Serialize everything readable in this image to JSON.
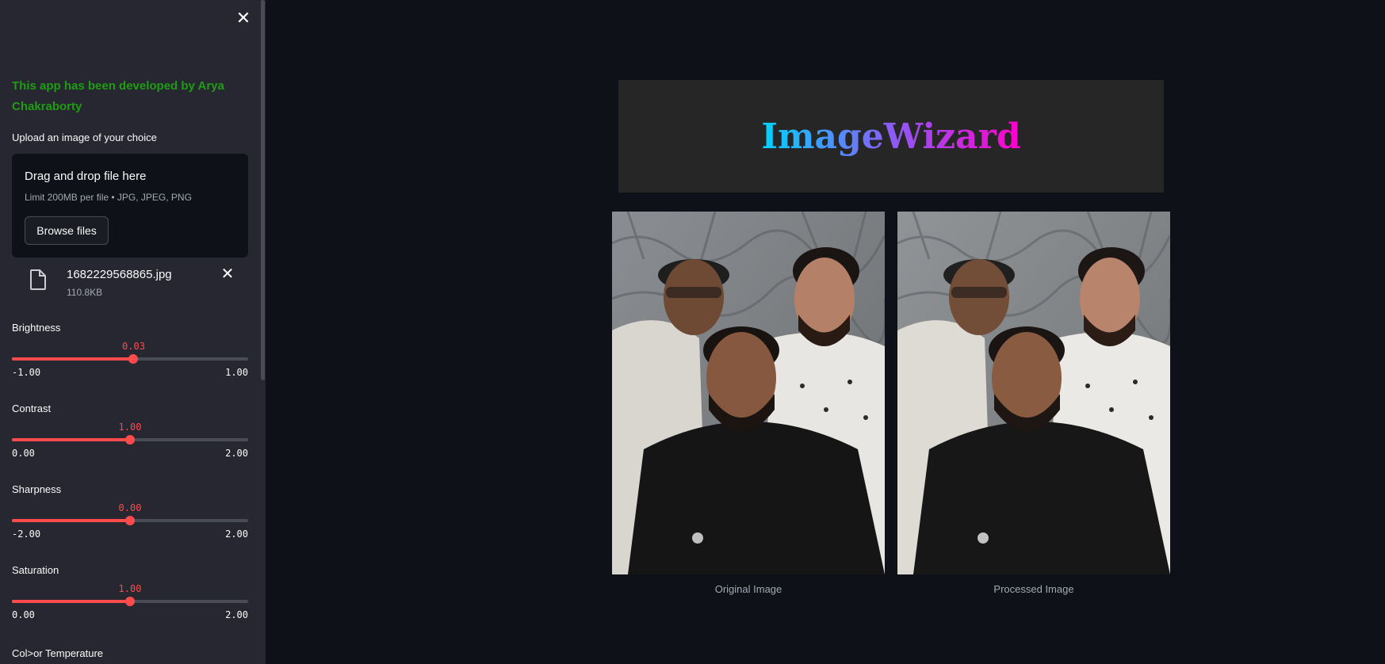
{
  "sidebar": {
    "close_icon": "close-icon",
    "developer_note": "This app has been developed by Arya Chakraborty",
    "upload": {
      "label": "Upload an image of your choice",
      "dropzone_title": "Drag and drop file here",
      "dropzone_limit": "Limit 200MB per file • JPG, JPEG, PNG",
      "browse_label": "Browse files"
    },
    "file": {
      "name": "1682229568865.jpg",
      "size": "110.8KB",
      "icon": "file-icon"
    },
    "sliders": [
      {
        "label": "Brightness",
        "value": "0.03",
        "min": "-1.00",
        "max": "1.00",
        "fraction": 0.515
      },
      {
        "label": "Contrast",
        "value": "1.00",
        "min": "0.00",
        "max": "2.00",
        "fraction": 0.5
      },
      {
        "label": "Sharpness",
        "value": "0.00",
        "min": "-2.00",
        "max": "2.00",
        "fraction": 0.5
      },
      {
        "label": "Saturation",
        "value": "1.00",
        "min": "0.00",
        "max": "2.00",
        "fraction": 0.5
      }
    ],
    "next_label": "Col>or Temperature"
  },
  "main": {
    "title": "ImageWizard",
    "images": [
      {
        "caption": "Original Image"
      },
      {
        "caption": "Processed Image"
      }
    ]
  },
  "colors": {
    "accent": "#ff4b4b",
    "developer_note": "#1f9d12"
  }
}
